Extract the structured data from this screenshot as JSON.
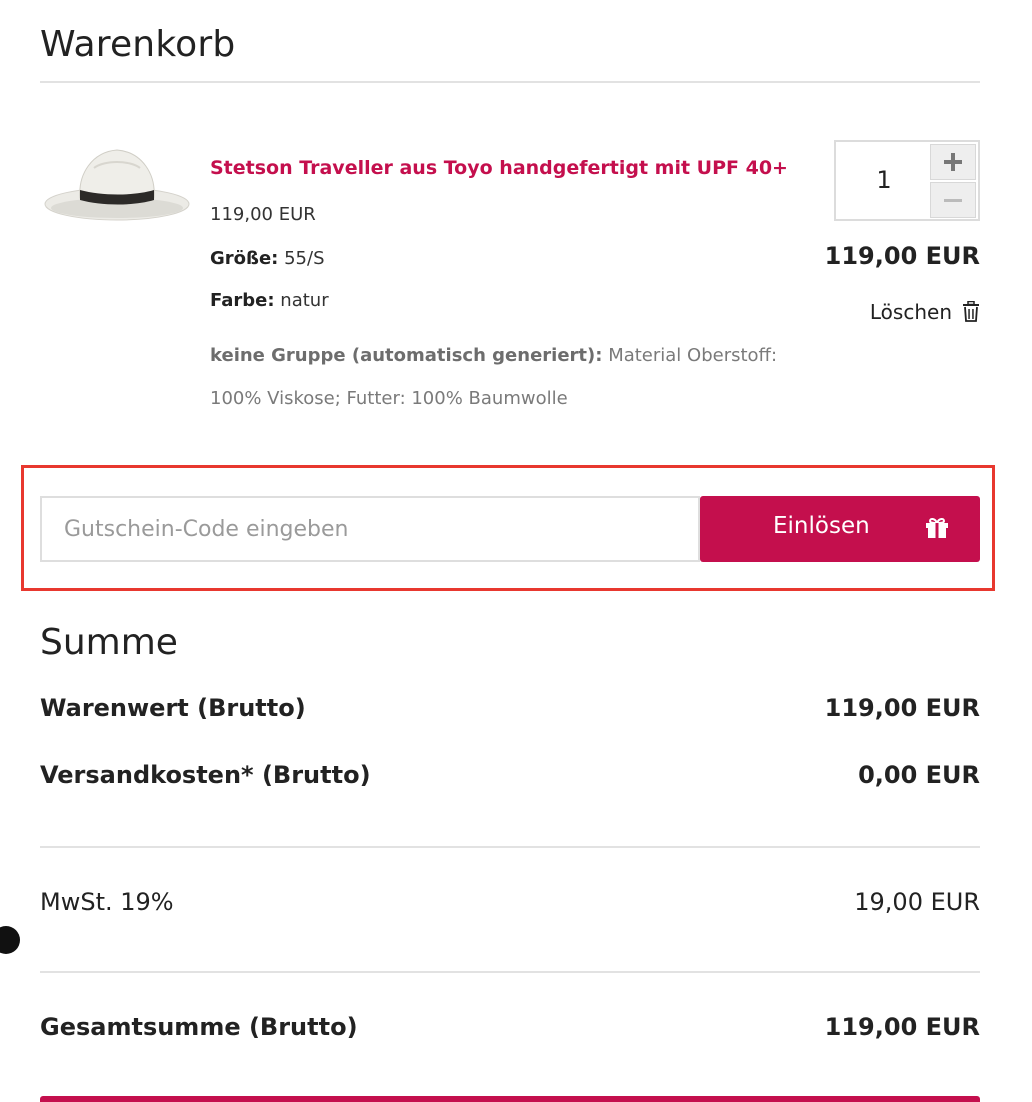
{
  "cart": {
    "title": "Warenkorb",
    "item": {
      "name": "Stetson Traveller aus Toyo handgefertigt mit UPF 40+",
      "unit_price": "119,00 EUR",
      "size_label": "Größe:",
      "size_value": "55/S",
      "color_label": "Farbe:",
      "color_value": "natur",
      "group_label": "keine Gruppe (automatisch generiert):",
      "group_value": "Material Oberstoff: 100% Viskose; Futter: 100% Baumwolle",
      "quantity": "1",
      "line_total": "119,00 EUR",
      "remove_label": "Löschen",
      "image_icon": "hat-image"
    }
  },
  "coupon": {
    "placeholder": "Gutschein-Code eingeben",
    "button_label": "Einlösen",
    "button_icon": "gift-icon"
  },
  "summary": {
    "title": "Summe",
    "goods_label": "Warenwert (Brutto)",
    "goods_value": "119,00 EUR",
    "shipping_label": "Versandkosten* (Brutto)",
    "shipping_value": "0,00 EUR",
    "vat_label": "MwSt. 19%",
    "vat_value": "19,00 EUR",
    "total_label": "Gesamtsumme (Brutto)",
    "total_value": "119,00 EUR"
  },
  "colors": {
    "accent": "#c40f4d",
    "highlight_outline": "#e8382f"
  }
}
